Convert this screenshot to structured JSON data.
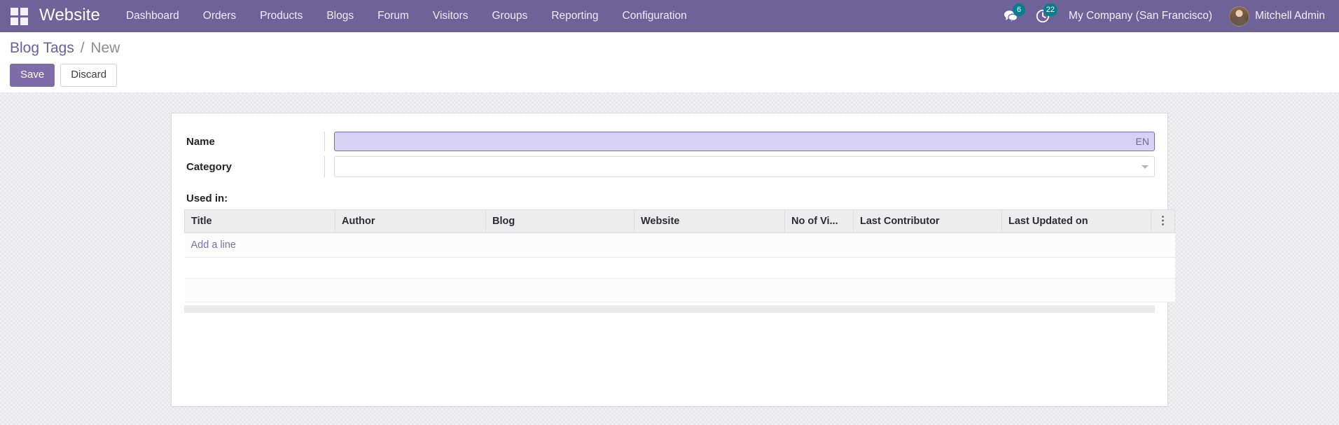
{
  "navbar": {
    "apps_icon": "apps-grid-icon",
    "brand": "Website",
    "menu": [
      {
        "label": "Dashboard"
      },
      {
        "label": "Orders"
      },
      {
        "label": "Products"
      },
      {
        "label": "Blogs"
      },
      {
        "label": "Forum"
      },
      {
        "label": "Visitors"
      },
      {
        "label": "Groups"
      },
      {
        "label": "Reporting"
      },
      {
        "label": "Configuration"
      }
    ],
    "messages": {
      "icon": "messages-icon",
      "count": "6"
    },
    "activities": {
      "icon": "clock-icon",
      "count": "22"
    },
    "company": "My Company (San Francisco)",
    "user": "Mitchell Admin",
    "avatar_alt": "user-avatar",
    "colors": {
      "bar": "#6e6299",
      "badge": "#00808f",
      "text": "#f2f0f7"
    }
  },
  "control_panel": {
    "breadcrumb": {
      "parent": "Blog Tags",
      "separator": "/",
      "current": "New"
    },
    "save_label": "Save",
    "discard_label": "Discard",
    "colors": {
      "primary": "#7c6ca8",
      "link": "#6a5fa0"
    }
  },
  "form": {
    "fields": [
      {
        "label": "Name",
        "value": "",
        "placeholder": "",
        "lang_tag": "EN",
        "focused": true
      },
      {
        "label": "Category",
        "value": "",
        "placeholder": "",
        "type": "dropdown"
      }
    ],
    "used_in_label": "Used in:",
    "table": {
      "columns": [
        "Title",
        "Author",
        "Blog",
        "Website",
        "No of Vi...",
        "Last Contributor",
        "Last Updated on"
      ],
      "options_icon": "vertical-dots-icon",
      "add_line_label": "Add a line",
      "rows": []
    }
  }
}
